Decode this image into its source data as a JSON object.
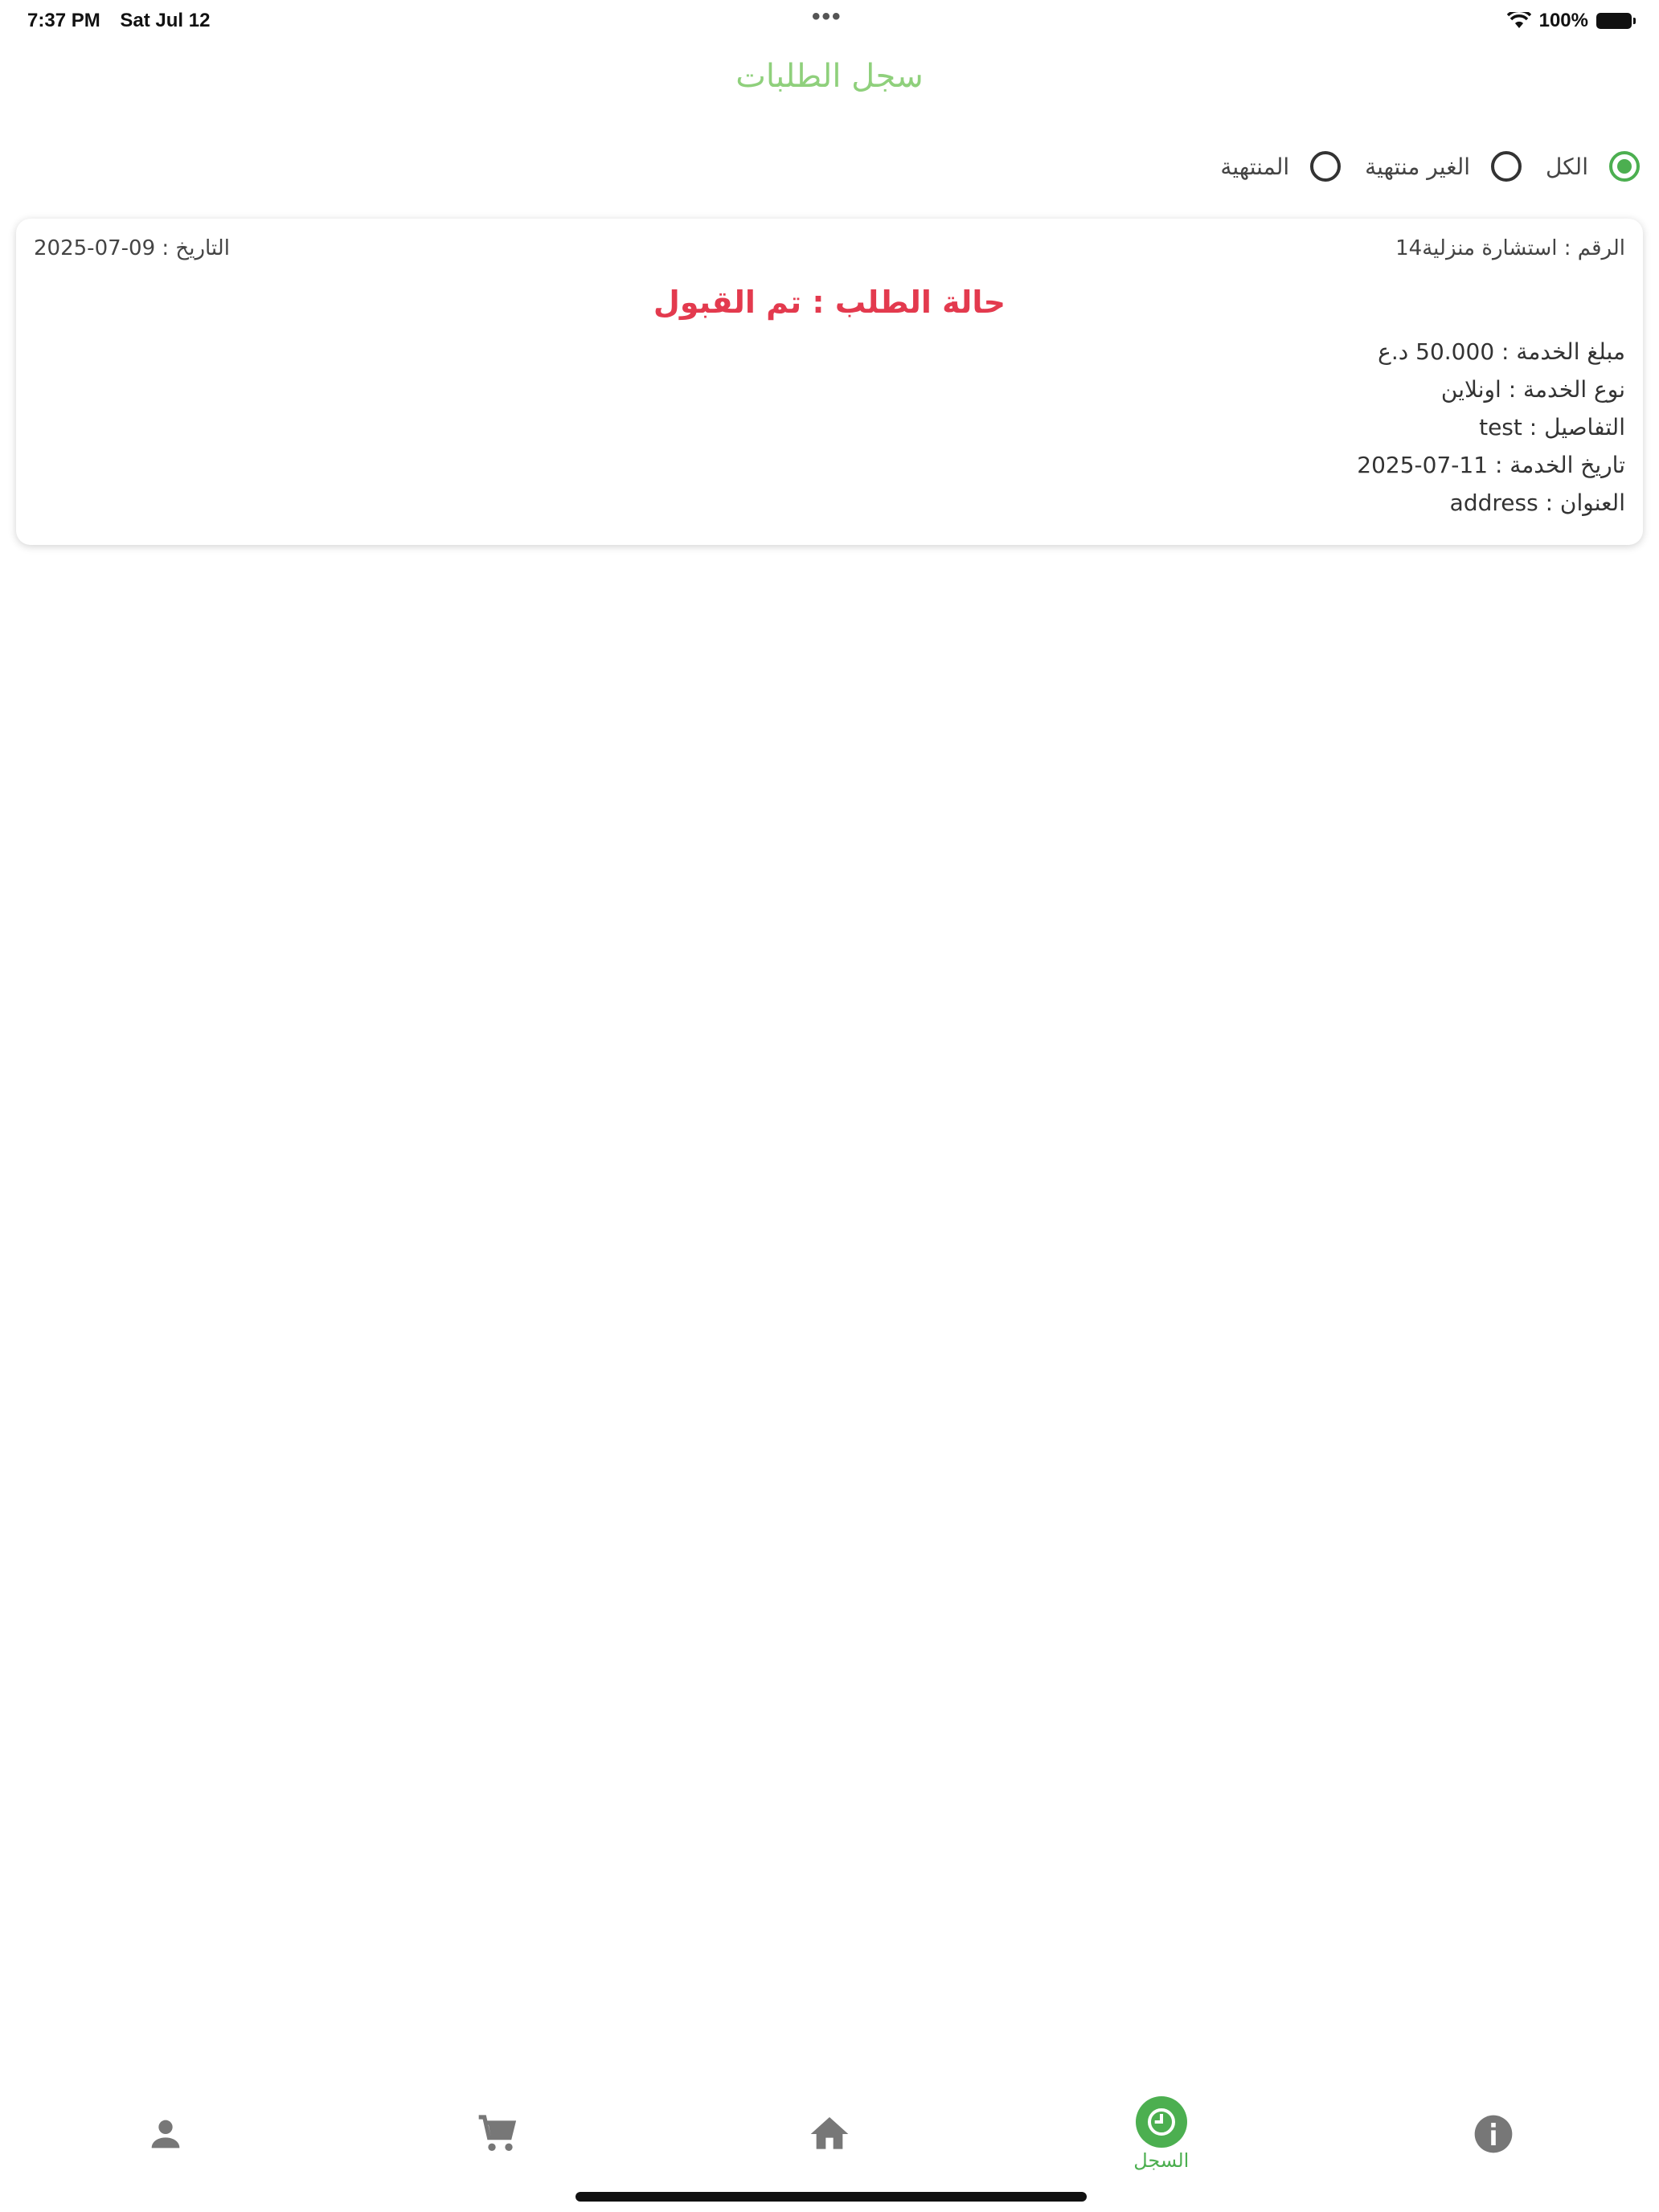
{
  "status_bar": {
    "time": "7:37 PM",
    "date": "Sat Jul 12",
    "dots": "•••",
    "battery_pct": "100%"
  },
  "header": {
    "title": "سجل الطلبات"
  },
  "filter": {
    "options": [
      {
        "label": "الكل",
        "checked": true
      },
      {
        "label": "الغير منتهية",
        "checked": false
      },
      {
        "label": "المنتهية",
        "checked": false
      }
    ]
  },
  "order": {
    "number": "الرقم : استشارة منزلية14",
    "date": "التاريخ : 09-07-2025",
    "status": "حالة الطلب : تم القبول",
    "amount": "مبلغ الخدمة : 50.000 د.ع",
    "service_type": "نوع الخدمة : اونلاين",
    "details": "التفاصيل : test",
    "service_date": "تاريخ الخدمة : 11-07-2025",
    "address": "العنوان : address"
  },
  "bottom_nav": {
    "items": [
      {
        "icon": "person-icon",
        "label": ""
      },
      {
        "icon": "cart-icon",
        "label": ""
      },
      {
        "icon": "home-icon",
        "label": ""
      },
      {
        "icon": "history-icon",
        "label": "السجل",
        "active": true
      },
      {
        "icon": "info-icon",
        "label": ""
      }
    ]
  },
  "colors": {
    "accent": "#4caf50",
    "title": "#8fd07c",
    "status": "#e33a4e"
  }
}
